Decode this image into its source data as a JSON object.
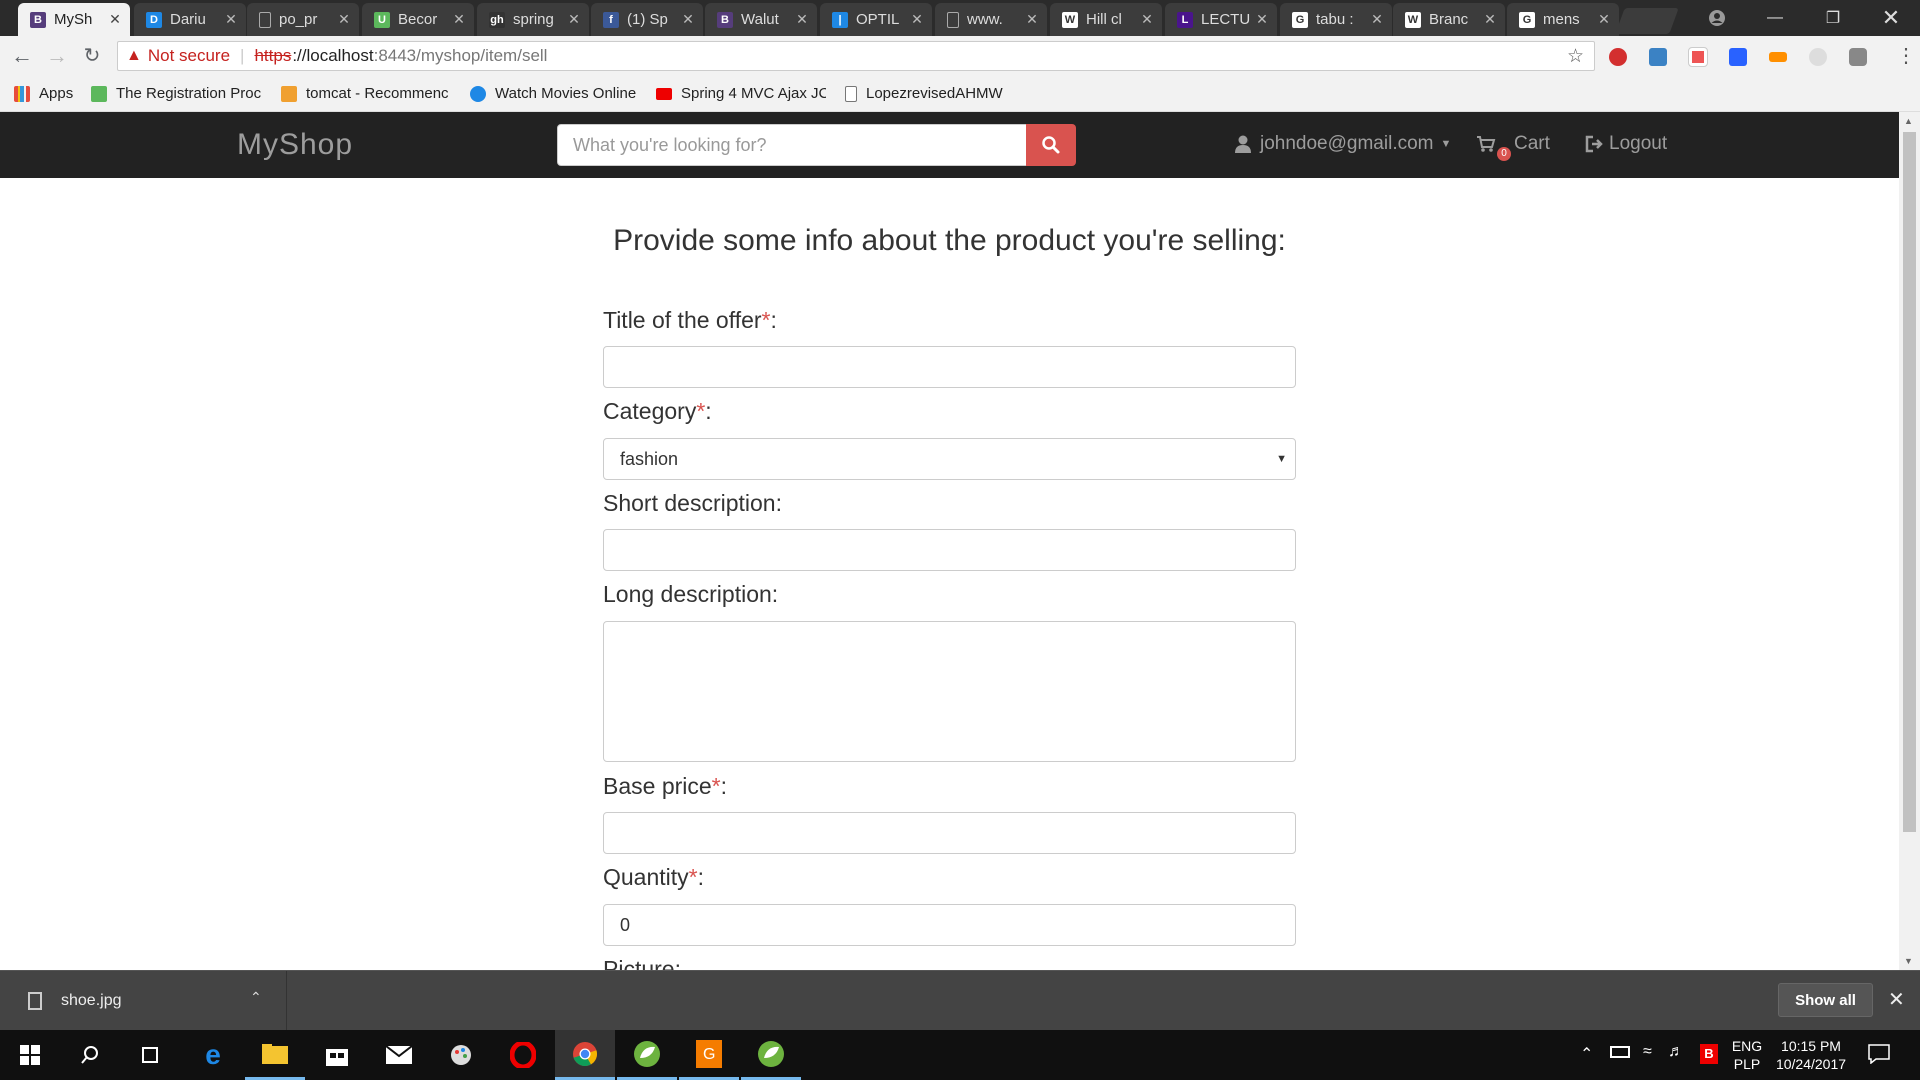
{
  "browser": {
    "tabs": [
      {
        "label": "MySh",
        "favicon": "B",
        "favicon_color": "#563d7c",
        "active": true
      },
      {
        "label": "Dariu",
        "favicon": "D",
        "favicon_color": "#1e88e5"
      },
      {
        "label": "po_pr",
        "favicon": "doc",
        "favicon_color": ""
      },
      {
        "label": "Becor",
        "favicon": "U",
        "favicon_color": "#5cb85c"
      },
      {
        "label": "spring",
        "favicon": "gh",
        "favicon_color": "#333"
      },
      {
        "label": "(1) Sp",
        "favicon": "f",
        "favicon_color": "#3b5998"
      },
      {
        "label": "Walut",
        "favicon": "B",
        "favicon_color": "#563d7c"
      },
      {
        "label": "OPTIL",
        "favicon": "|",
        "favicon_color": "#1e88e5"
      },
      {
        "label": "www.",
        "favicon": "doc",
        "favicon_color": ""
      },
      {
        "label": "Hill cl",
        "favicon": "W",
        "favicon_color": "#fff"
      },
      {
        "label": "LECTU",
        "favicon": "L",
        "favicon_color": "#4a148c"
      },
      {
        "label": "tabu :",
        "favicon": "G",
        "favicon_color": "#fff"
      },
      {
        "label": "Branc",
        "favicon": "W",
        "favicon_color": "#fff"
      },
      {
        "label": "mens",
        "favicon": "G",
        "favicon_color": "#fff"
      }
    ],
    "address": {
      "warning_text": "Not secure",
      "protocol": "https",
      "host": "://localhost",
      "path": ":8443/myshop/item/sell"
    },
    "bookmarks": [
      {
        "label": "Apps",
        "color": "#e74c3c"
      },
      {
        "label": "The Registration Proc",
        "color": "#5cb85c"
      },
      {
        "label": "tomcat - Recommenc",
        "color": "#f0a030"
      },
      {
        "label": "Watch Movies Online",
        "color": "#1e88e5"
      },
      {
        "label": "Spring 4 MVC Ajax JC",
        "color": "#e00"
      },
      {
        "label": "LopezrevisedAHMW",
        "color": "#ccc"
      }
    ]
  },
  "navbar": {
    "brand": "MyShop",
    "search_placeholder": "What you're looking for?",
    "user": "johndoe@gmail.com",
    "cart_label": "Cart",
    "cart_count": "0",
    "logout_label": "Logout"
  },
  "form": {
    "heading": "Provide some info about the product you're selling:",
    "title_label": "Title of the offer",
    "category_label": "Category",
    "category_value": "fashion",
    "short_desc_label": "Short description:",
    "long_desc_label": "Long description:",
    "base_price_label": "Base price",
    "quantity_label": "Quantity",
    "quantity_value": "0",
    "picture_label": "Picture:",
    "required_mark": "*",
    "colon": ":"
  },
  "download_bar": {
    "file_name": "shoe.jpg",
    "show_all_label": "Show all"
  },
  "taskbar": {
    "lang_top": "ENG",
    "lang_bottom": "PLP",
    "time": "10:15 PM",
    "date": "10/24/2017"
  }
}
